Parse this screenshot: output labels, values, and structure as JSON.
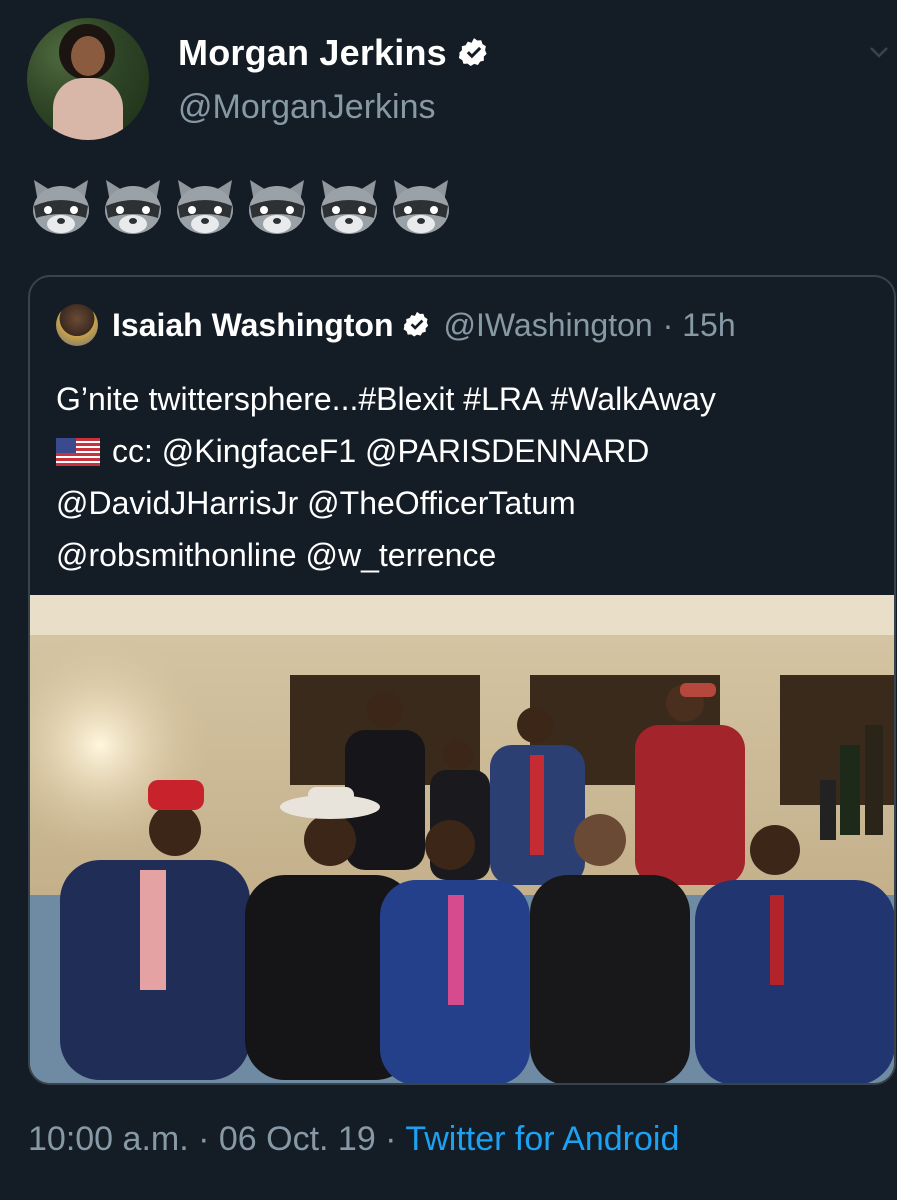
{
  "tweet": {
    "author": {
      "display_name": "Morgan Jerkins",
      "handle": "@MorganJerkins",
      "verified": true
    },
    "text_emoji": [
      "raccoon",
      "raccoon",
      "raccoon",
      "raccoon",
      "raccoon",
      "raccoon"
    ],
    "quoted_tweet": {
      "author": {
        "display_name": "Isaiah Washington",
        "handle": "@IWashington",
        "verified": true
      },
      "age": "· 15h",
      "text_lines": [
        "G’nite twittersphere...#Blexit #LRA #WalkAway",
        "cc: @KingfaceF1  @PARISDENNARD",
        "@DavidJHarrisJr @TheOfficerTatum",
        "@robsmithonline @w_terrence"
      ],
      "flag_emoji": "us-flag"
    },
    "timestamp": "10:00 a.m. · 06 Oct. 19 ·",
    "source": "Twitter for Android"
  },
  "colors": {
    "background": "#141d26",
    "primary_text": "#ffffff",
    "secondary_text": "#8899a6",
    "link": "#1da1f2",
    "border": "#38444d"
  }
}
